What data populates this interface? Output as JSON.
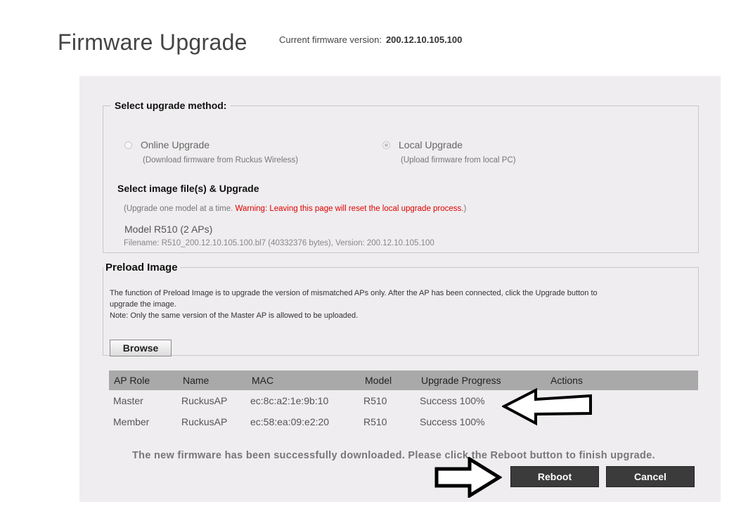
{
  "header": {
    "title": "Firmware Upgrade",
    "version_label": "Current firmware version:",
    "version_value": "200.12.10.105.100"
  },
  "upgrade_method": {
    "legend": "Select upgrade method:",
    "online": {
      "label": "Online Upgrade",
      "sub": "(Download firmware from Ruckus Wireless)",
      "checked": false
    },
    "local": {
      "label": "Local Upgrade",
      "sub": "(Upload firmware from local PC)",
      "checked": true
    },
    "image_heading": "Select image file(s) & Upgrade",
    "note_prefix": "(Upgrade one model at a time.",
    "warning": "Warning: Leaving this page will reset the local upgrade process.",
    "note_suffix": ")",
    "model": "Model R510 (2 APs)",
    "filename": "Filename: R510_200.12.10.105.100.bl7 (40332376 bytes), Version: 200.12.10.105.100"
  },
  "preload": {
    "legend": "Preload Image",
    "line1": "The function of Preload Image is to upgrade the version of mismatched APs only. After the AP has been connected, click the Upgrade button to",
    "line2": "upgrade the image.",
    "line3": "Note: Only the same version of the Master AP is allowed to be uploaded.",
    "browse_label": "Browse"
  },
  "ap_table": {
    "headers": [
      "AP Role",
      "Name",
      "MAC",
      "Model",
      "Upgrade Progress",
      "Actions"
    ],
    "rows": [
      [
        "Master",
        "RuckusAP",
        "ec:8c:a2:1e:9b:10",
        "R510",
        "Success 100%",
        ""
      ],
      [
        "Member",
        "RuckusAP",
        "ec:58:ea:09:e2:20",
        "R510",
        "Success 100%",
        ""
      ]
    ]
  },
  "footer": {
    "message": "The new firmware has been successfully downloaded. Please click the Reboot button to finish upgrade.",
    "reboot_label": "Reboot",
    "cancel_label": "Cancel"
  },
  "colors": {
    "panel_bg": "#efedef",
    "table_header_bg": "#a9a9a9",
    "warning_red": "#e00000",
    "button_dark": "#3b3b3b"
  },
  "icons": [
    "left-arrow-annotation-icon",
    "right-arrow-annotation-icon"
  ]
}
